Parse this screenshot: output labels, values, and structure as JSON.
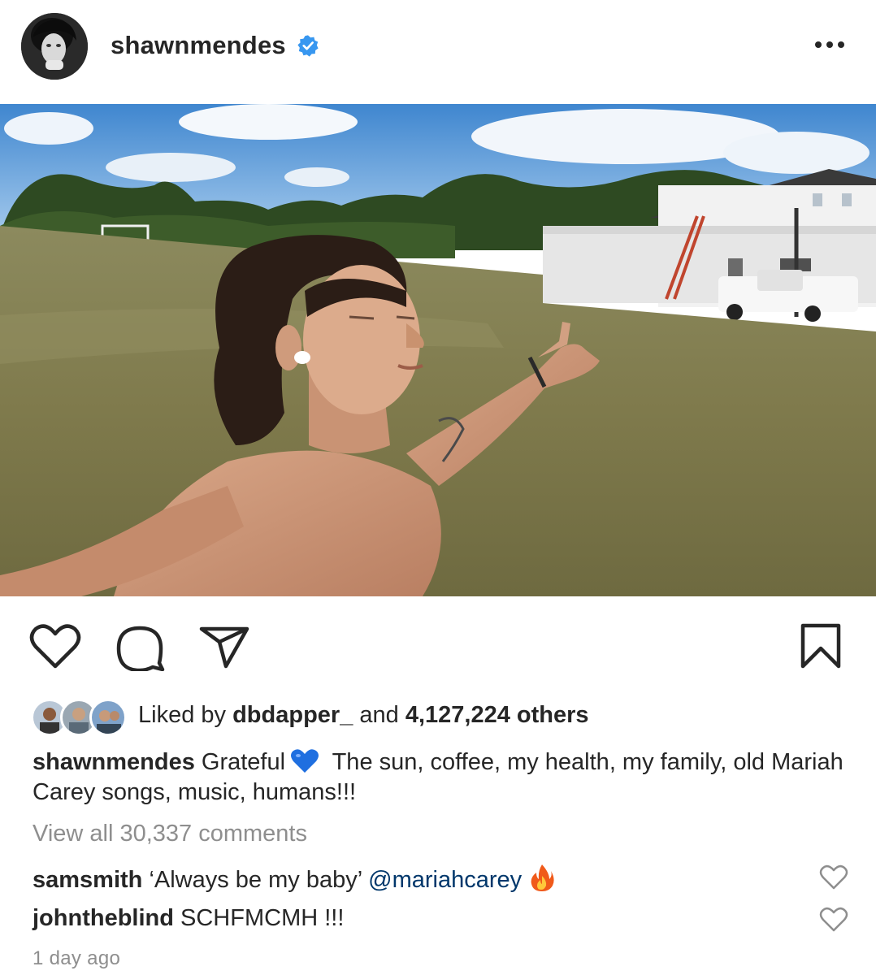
{
  "post": {
    "author": "shawnmendes",
    "verified": true,
    "icons": {
      "avatar": "profile-photo",
      "verified": "verified-badge-icon",
      "more": "more-options-icon",
      "like": "heart-icon",
      "comment": "comment-bubble-icon",
      "share": "paper-plane-icon",
      "save": "bookmark-icon"
    }
  },
  "likes": {
    "prefix": "Liked by ",
    "user": "dbdapper_",
    "middle": " and ",
    "count": "4,127,224 others"
  },
  "caption": {
    "user": "shawnmendes",
    "text_before": " Grateful",
    "emoji": "blue-heart",
    "text_after": " The sun, coffee, my health, my family, old Mariah Carey songs, music, humans!!!"
  },
  "view_all_comments": "View all 30,337 comments",
  "comments": [
    {
      "user": "samsmith",
      "text": " ‘Always be my baby’ ",
      "mention": "@mariahcarey",
      "emoji": "fire"
    },
    {
      "user": "johntheblind",
      "text": " SCHFMCMH !!!"
    }
  ],
  "timestamp": "1 day ago",
  "colors": {
    "text": "#262626",
    "secondary": "#8e8e8e",
    "mention": "#00376b",
    "verified": "#3897f0"
  }
}
